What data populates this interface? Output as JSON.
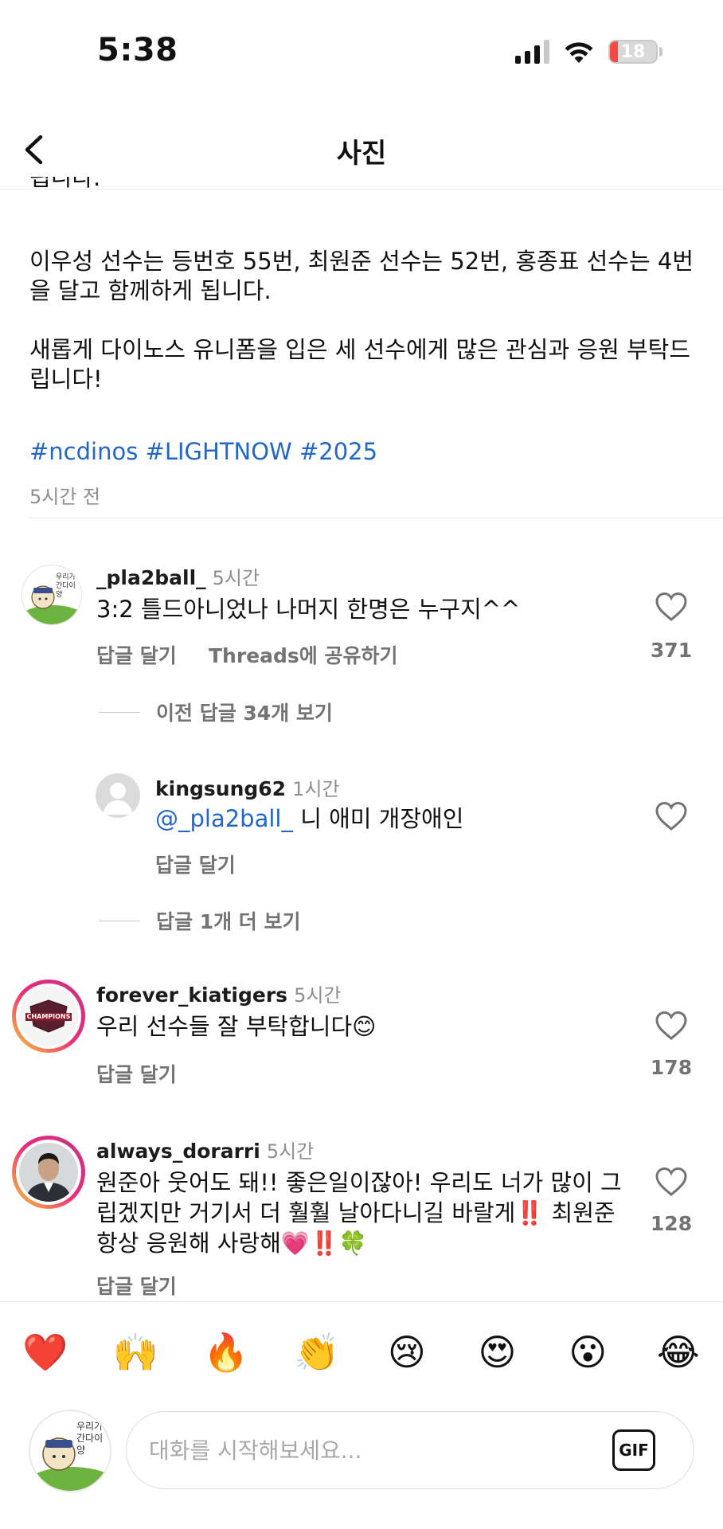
{
  "status": {
    "time": "5:38",
    "battery": "18",
    "battery_level_percent": 18
  },
  "header": {
    "title": "사진"
  },
  "caption": {
    "cut_line": "됩니다.",
    "para1": "이우성 선수는 등번호 55번, 최원준 선수는 52번, 홍종표 선수는 4번을 달고 함께하게 됩니다.",
    "para2": "새롭게 다이노스 유니폼을 입은 세 선수에게 많은 관심과 응원 부탁드립니다!",
    "hashtags": "#ncdinos #LIGHTNOW #2025",
    "time": "5시간 전"
  },
  "comments": [
    {
      "username": "_pla2ball_",
      "time": "5시간",
      "text": "3:2 틀드아니었나 나머지 한명은 누구지^^",
      "reply_label": "답글 달기",
      "share_label": "Threads에 공유하기",
      "likes": "371",
      "avatar_icon": "bear-avatar-icon",
      "avatar_text": "우리가 간다이양",
      "view_previous": "이전 답글 34개 보기"
    },
    {
      "username": "kingsung62",
      "time": "1시간",
      "mention": "@_pla2ball_",
      "text": " 니 애미 개장애인",
      "reply_label": "답글 달기",
      "avatar_icon": "default-user-icon",
      "view_more": "답글 1개 더 보기"
    },
    {
      "username": "forever_kiatigers",
      "time": "5시간",
      "text": "우리 선수들 잘 부탁합니다😊",
      "reply_label": "답글 달기",
      "likes": "178",
      "avatar_icon": "champions-logo-icon",
      "avatar_text": "CHAMPIONS"
    },
    {
      "username": "always_dorarri",
      "time": "5시간",
      "text": "원준아 웃어도 돼!! 좋은일이잖아! 우리도 너가 많이 그립겠지만 거기서 더 훨훨 날아다니길 바랄게‼️ 최원준 항상 응원해 사랑해💗‼️🍀",
      "reply_label": "답글 달기",
      "likes": "128",
      "avatar_icon": "person-photo-icon"
    }
  ],
  "emoji_bar": [
    "❤️",
    "🙌",
    "🔥",
    "👏",
    "😢",
    "😍",
    "😮",
    "😂"
  ],
  "compose": {
    "placeholder": "대화를 시작해보세요...",
    "gif_label": "GIF",
    "avatar_text": "우리가 간다이양"
  },
  "colors": {
    "link_blue": "#2367c6",
    "muted_gray": "#737373",
    "battery_red": "#f24b45",
    "story_ring_start": "#f9ce34",
    "story_ring_end": "#d62976"
  }
}
